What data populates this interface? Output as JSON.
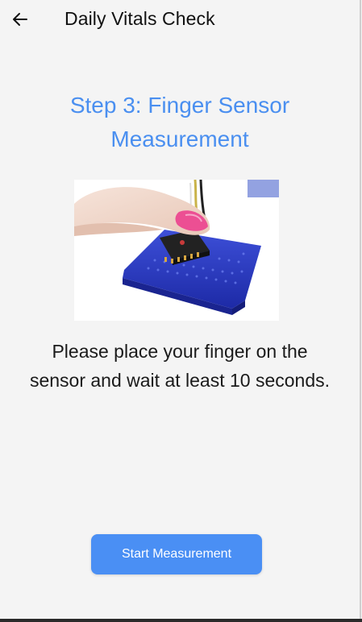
{
  "header": {
    "title": "Daily Vitals Check",
    "back_icon": "arrow-left-icon"
  },
  "step": {
    "title": "Step 3: Finger Sensor Measurement"
  },
  "image": {
    "subject": "finger-on-pulse-sensor-breadboard"
  },
  "instruction": {
    "text": "Please place your finger on the sensor and wait at least 10 seconds."
  },
  "action": {
    "start_label": "Start Measurement"
  },
  "colors": {
    "accent": "#4a8ff4",
    "background": "#f4f4f4",
    "title_text": "#111111"
  }
}
